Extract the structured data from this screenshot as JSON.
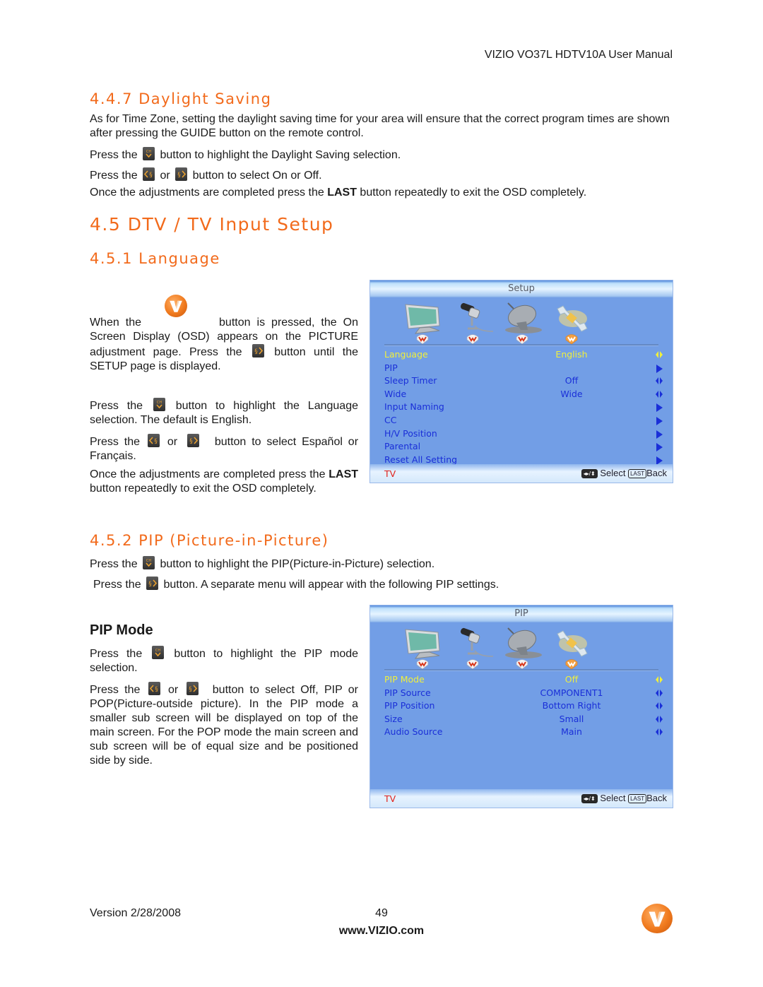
{
  "header": {
    "title": "VIZIO VO37L HDTV10A User Manual"
  },
  "section_447": {
    "heading": "4.4.7 Daylight Saving",
    "para1": "As for Time Zone, setting the daylight saving time for your area will ensure that the correct program times are shown after pressing the GUIDE button on the remote control.",
    "press1_a": "Press the",
    "press1_b": "button to highlight the Daylight Saving selection.",
    "press2_a": "Press the",
    "press2_or": "or",
    "press2_b": "button to select On or Off.",
    "last_a": "Once the adjustments are completed press the",
    "last_bold": "LAST",
    "last_b": "button repeatedly to exit the OSD completely."
  },
  "section_45": {
    "heading": "4.5 DTV / TV Input Setup"
  },
  "section_451": {
    "heading": "4.5.1 Language",
    "p1_a": "When the",
    "p1_b": "button is pressed, the On Screen Display (OSD) appears on the PICTURE adjustment page.  Press the",
    "p1_c": "button until the SETUP page is displayed.",
    "p2_a": "Press the",
    "p2_b": "button to highlight the Language selection.  The default is English.",
    "p3_a": "Press the",
    "p3_or": "or",
    "p3_b": "button to select Español or Français.",
    "p4_a": "Once the adjustments are completed press the",
    "p4_bold": "LAST",
    "p4_b": "button repeatedly to exit the OSD completely."
  },
  "setup_menu": {
    "title": "Setup",
    "rows": [
      {
        "label": "Language",
        "value": "English",
        "arrow": "left-right",
        "selected": true
      },
      {
        "label": "PIP",
        "value": "",
        "arrow": "right"
      },
      {
        "label": "Sleep Timer",
        "value": "Off",
        "arrow": "left-right"
      },
      {
        "label": "Wide",
        "value": "Wide",
        "arrow": "left-right"
      },
      {
        "label": "Input Naming",
        "value": "",
        "arrow": "right"
      },
      {
        "label": "CC",
        "value": "",
        "arrow": "right"
      },
      {
        "label": "H/V Position",
        "value": "",
        "arrow": "right"
      },
      {
        "label": "Parental",
        "value": "",
        "arrow": "right"
      },
      {
        "label": "Reset All Setting",
        "value": "",
        "arrow": "right"
      }
    ],
    "footer_source": "TV",
    "footer_select": "Select",
    "footer_key": "LAST",
    "footer_back": "Back"
  },
  "section_452": {
    "heading": "4.5.2 PIP (Picture-in-Picture)",
    "p1_a": "Press the",
    "p1_b": "button to highlight the PIP(Picture-in-Picture) selection.",
    "p2_a": "Press the",
    "p2_b": "button. A separate menu will appear with the following PIP settings."
  },
  "pip_mode": {
    "heading": "PIP Mode",
    "p1_a": "Press the",
    "p1_b": "button to highlight the PIP mode selection.",
    "p2_a": "Press the",
    "p2_or": "or",
    "p2_b": "button to select Off, PIP or POP(Picture-outside picture). In the PIP mode a smaller sub screen will be displayed on top of the main screen. For the POP mode the main screen and sub screen will be of equal size and be positioned side by side."
  },
  "pip_menu": {
    "title": "PIP",
    "rows": [
      {
        "label": "PIP Mode",
        "value": "Off",
        "arrow": "left-right",
        "selected": true
      },
      {
        "label": "PIP Source",
        "value": "COMPONENT1",
        "arrow": "left-right"
      },
      {
        "label": "PIP Position",
        "value": "Bottom Right",
        "arrow": "left-right"
      },
      {
        "label": "Size",
        "value": "Small",
        "arrow": "left-right"
      },
      {
        "label": "Audio Source",
        "value": "Main",
        "arrow": "left-right"
      }
    ],
    "footer_source": "TV",
    "footer_select": "Select",
    "footer_key": "LAST",
    "footer_back": "Back"
  },
  "footer": {
    "version": "Version 2/28/2008",
    "page_number": "49",
    "website": "www.VIZIO.com"
  },
  "colors": {
    "heading": "#f26a1b",
    "osd_bg": "#729ee6",
    "osd_text": "#1a2fd8",
    "osd_selected": "#f1f03a",
    "osd_tv": "#e0201a",
    "vizio_orange": "#f07a1e"
  }
}
